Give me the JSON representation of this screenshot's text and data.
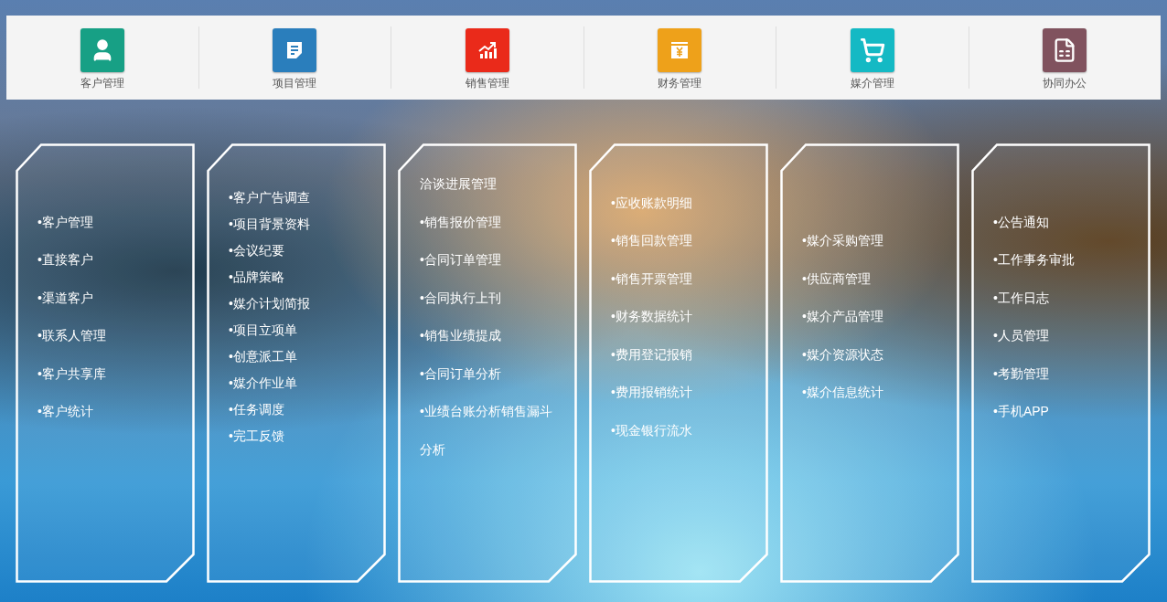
{
  "modules": [
    {
      "label": "客户管理",
      "color": "#17a085"
    },
    {
      "label": "项目管理",
      "color": "#2a7ebc"
    },
    {
      "label": "销售管理",
      "color": "#ea2a1a"
    },
    {
      "label": "财务管理",
      "color": "#eea11a"
    },
    {
      "label": "媒介管理",
      "color": "#14b9c4"
    },
    {
      "label": "协同办公",
      "color": "#80525e"
    }
  ],
  "panels": [
    {
      "items": [
        "•客户管理",
        "•直接客户",
        "•渠道客户",
        "•联系人管理",
        "•客户共享库",
        "•客户统计"
      ]
    },
    {
      "items": [
        "•客户广告调查",
        "•项目背景资料",
        "•会议纪要",
        "•品牌策略",
        "•媒介计划简报",
        "•项目立项单",
        "•创意派工单",
        "•媒介作业单",
        "•任务调度",
        "•完工反馈"
      ]
    },
    {
      "items": [
        "洽谈进展管理",
        "•销售报价管理",
        "•合同订单管理",
        "•合同执行上刊",
        "•销售业绩提成",
        "•合同订单分析",
        "•业绩台账分析销售漏斗分析"
      ]
    },
    {
      "items": [
        "•应收账款明细",
        "•销售回款管理",
        "•销售开票管理",
        "•财务数据统计",
        "•费用登记报销",
        "•费用报销统计",
        "•现金银行流水"
      ]
    },
    {
      "items": [
        "•媒介采购管理",
        "•供应商管理",
        "•媒介产品管理",
        "•媒介资源状态",
        "•媒介信息统计"
      ]
    },
    {
      "items": [
        "•公告通知",
        "•工作事务审批",
        "•工作日志",
        "•人员管理",
        "•考勤管理",
        "•手机APP"
      ]
    }
  ]
}
